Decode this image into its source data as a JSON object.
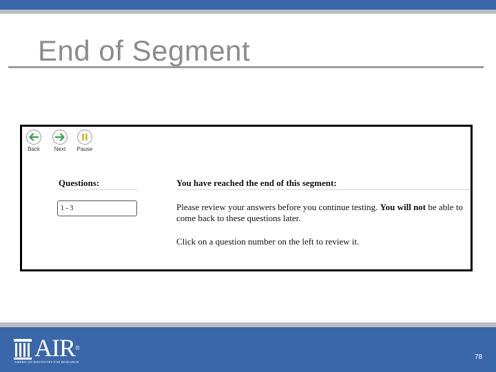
{
  "slide": {
    "title": "End of Segment",
    "page_number": "78"
  },
  "toolbar": {
    "back_label": "Back",
    "next_label": "Next",
    "pause_label": "Pause",
    "back_icon": "arrow-left-icon",
    "next_icon": "arrow-right-icon",
    "pause_icon": "pause-icon"
  },
  "questions": {
    "heading": "Questions:",
    "range": "1 - 3"
  },
  "segment": {
    "heading": "You have reached the end of this segment:",
    "p1_before": "Please review your answers before you continue testing. ",
    "p1_bold": "You will not",
    "p1_after": " be able to come back to these questions later.",
    "p2": "Click on a question number on the left to review it."
  },
  "logo": {
    "text": "AIR",
    "registered": "®",
    "subtitle": "AMERICAN INSTITUTES FOR RESEARCH"
  },
  "colors": {
    "band_blue": "#3a67a9",
    "band_gray": "#b9bcc2",
    "title_gray": "#8c8c8c",
    "back_green": "#2ea44f",
    "next_green": "#2ea44f",
    "pause_yellow": "#d4a900"
  }
}
